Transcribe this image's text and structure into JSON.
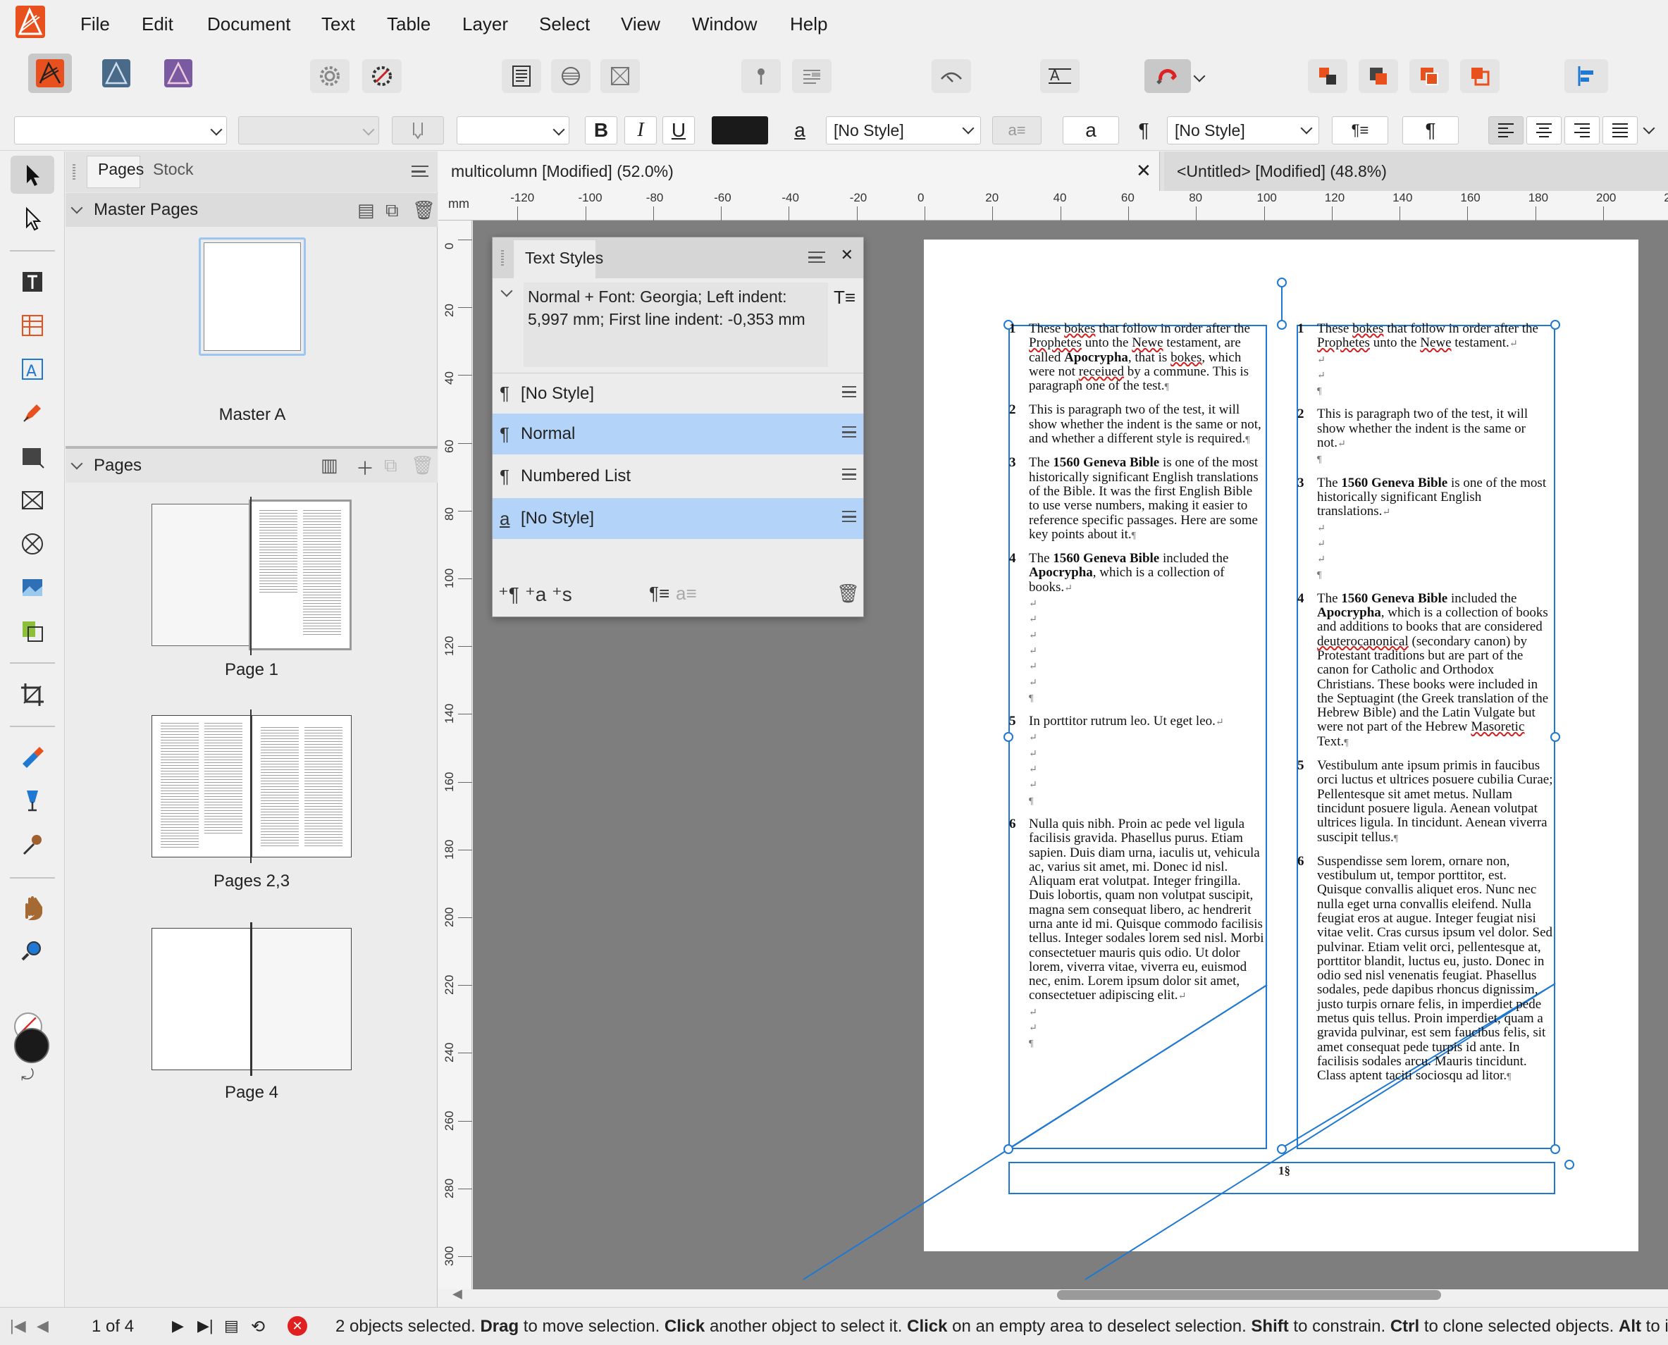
{
  "menu": [
    "File",
    "Edit",
    "Document",
    "Text",
    "Table",
    "Layer",
    "Select",
    "View",
    "Window",
    "Help"
  ],
  "context_bar": {
    "style_left": "[No Style]",
    "style_right": "[No Style]",
    "bold": "B",
    "italic": "I",
    "underline": "U",
    "char_a": "a"
  },
  "left_panel": {
    "tabs": [
      "Pages",
      "Stock"
    ],
    "master_section": "Master Pages",
    "master_label": "Master A",
    "pages_section": "Pages",
    "pages": [
      "Page 1",
      "Pages 2,3",
      "Page 4"
    ]
  },
  "doc_tabs": {
    "active": "multicolumn [Modified] (52.0%)",
    "inactive": "<Untitled> [Modified] (48.8%)",
    "close": "✕"
  },
  "rulers": {
    "unit": "mm",
    "h_ticks": [
      "-120",
      "-100",
      "-80",
      "-60",
      "-40",
      "-20",
      "0",
      "20",
      "40",
      "60",
      "80",
      "100",
      "120",
      "140",
      "160",
      "180",
      "200",
      "2"
    ],
    "v_ticks": [
      "0",
      "20",
      "40",
      "60",
      "80",
      "100",
      "120",
      "140",
      "160",
      "180",
      "200",
      "220",
      "240",
      "260",
      "280",
      "300"
    ]
  },
  "text_styles_panel": {
    "title": "Text Styles",
    "description": "Normal + Font: Georgia; Left indent: 5,997 mm; First line indent: -0,353 mm",
    "styles": [
      {
        "icon": "¶",
        "name": "[No Style]",
        "selected": false
      },
      {
        "icon": "¶",
        "name": "Normal",
        "selected": true
      },
      {
        "icon": "¶",
        "name": "Numbered List",
        "selected": false
      },
      {
        "icon": "a",
        "name": "[No Style]",
        "selected": true
      }
    ]
  },
  "document": {
    "page_number": "1§",
    "left_column": [
      {
        "n": "1",
        "text": "These bokes that follow in order after the Prophetes unto the Newe testament, are called Apocrypha, that is bokes, which were not receiued by a commune. This is paragraph one of the test.¶"
      },
      {
        "n": "2",
        "text": "This is paragraph two of the test, it will show whether the indent is the same or not, and whether a different style is required.¶"
      },
      {
        "n": "3",
        "text": "The 1560 Geneva Bible is one of the most historically significant English translations of the Bible. It was the first English Bible to use verse numbers, making it easier to reference specific passages. Here are some key points about it.¶"
      },
      {
        "n": "4",
        "text": "The 1560 Geneva Bible included the Apocrypha, which is a collection of books.↵ ↵ ↵ ↵ ↵ ↵ ↵ ¶"
      },
      {
        "n": "5",
        "text": "In porttitor rutrum leo. Ut eget leo.↵ ↵ ↵ ↵ ↵ ¶"
      },
      {
        "n": "6",
        "text": "Nulla quis nibh. Proin ac pede vel ligula facilisis gravida. Phasellus purus. Etiam sapien. Duis diam urna, iaculis ut, vehicula ac, varius sit amet, mi. Donec id nisl. Aliquam erat volutpat. Integer fringilla. Duis lobortis, quam non volutpat suscipit, magna sem consequat libero, ac hendrerit urna ante id mi. Quisque commodo facilisis tellus. Integer sodales lorem sed nisl. Morbi consectetuer mauris quis odio. Ut dolor lorem, viverra vitae, viverra eu, euismod nec, enim. Lorem ipsum dolor sit amet, consectetuer adipiscing elit.↵ ↵ ↵ ¶"
      }
    ],
    "right_column": [
      {
        "n": "1",
        "text": "These bokes that follow in order after the Prophetes unto the Newe testament.↵ ↵ ↵ ¶"
      },
      {
        "n": "2",
        "text": "This is paragraph two of the test, it will show whether the indent is the same or not.↵ ¶"
      },
      {
        "n": "3",
        "text": "The 1560 Geneva Bible is one of the most historically significant English translations.↵ ↵ ↵ ↵ ¶"
      },
      {
        "n": "4",
        "text": "The 1560 Geneva Bible included the Apocrypha, which is a collection of books and additions to books that are considered deuterocanonical (secondary canon) by Protestant traditions but are part of the canon for Catholic and Orthodox Christians. These books were included in the Septuagint (the Greek translation of the Hebrew Bible) and the Latin Vulgate but were not part of the Hebrew Masoretic Text.¶"
      },
      {
        "n": "5",
        "text": "Vestibulum ante ipsum primis in faucibus orci luctus et ultrices posuere cubilia Curae; Pellentesque sit amet metus. Nullam tincidunt posuere ligula. Aenean volutpat ultrices ligula. In tincidunt. Aenean viverra suscipit tellus.¶"
      },
      {
        "n": "6",
        "text": "Suspendisse sem lorem, ornare non, vestibulum ut, tempor porttitor, est. Quisque convallis aliquet eros. Nunc nec nulla eget urna convallis eleifend. Nulla feugiat eros at augue. Integer feugiat nisi vitae velit. Cras cursus ipsum vel dolor. Sed pulvinar. Etiam velit orci, pellentesque at, porttitor blandit, luctus eu, justo. Donec in odio sed nisl venenatis feugiat. Phasellus sodales, pede dapibus rhoncus dignissim, justo turpis ornare felis, in imperdiet pede metus quis tellus. Proin imperdiet, quam a gravida pulvinar, est sem faucibus felis, sit amet consequat pede turpis id ante. In facilisis sodales arcu. Mauris tincidunt. Class aptent taciti sociosqu ad litor.¶"
      }
    ]
  },
  "status": {
    "page_indicator": "1 of 4",
    "message_parts": [
      {
        "t": "2 objects selected. ",
        "b": false
      },
      {
        "t": "Drag",
        "b": true
      },
      {
        "t": " to move selection. ",
        "b": false
      },
      {
        "t": "Click",
        "b": true
      },
      {
        "t": " another object to select it. ",
        "b": false
      },
      {
        "t": "Click",
        "b": true
      },
      {
        "t": " on an empty area to deselect selection. ",
        "b": false
      },
      {
        "t": "Shift",
        "b": true
      },
      {
        "t": " to constrain. ",
        "b": false
      },
      {
        "t": "Ctrl",
        "b": true
      },
      {
        "t": " to clone selected objects. ",
        "b": false
      },
      {
        "t": "Alt",
        "b": true
      },
      {
        "t": " to ig",
        "b": false
      }
    ]
  },
  "colors": {
    "accent": "#1f78d1",
    "selection": "#b3d4f8",
    "canvas": "#7e7e7e",
    "affinity_red": "#e8501e"
  }
}
